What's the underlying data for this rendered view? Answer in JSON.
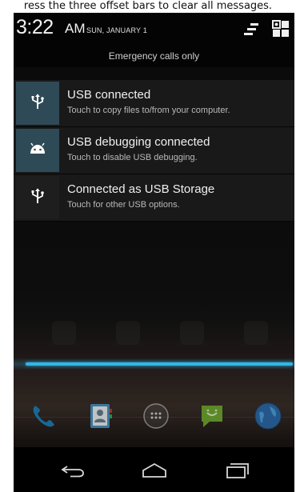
{
  "instruction": "ress the three offset bars to clear all messages.",
  "status": {
    "time": "3:22",
    "ampm": "AM",
    "date": "SUN, JANUARY 1",
    "clear_icon": "clear-all-icon",
    "settings_icon": "quick-settings-icon"
  },
  "emergency": "Emergency calls only",
  "notifications": [
    {
      "title": "USB connected",
      "text": "Touch to copy files to/from your computer.",
      "icon": "usb-icon",
      "icon_bg": "#2e4a56"
    },
    {
      "title": "USB debugging connected",
      "text": "Touch to disable USB debugging.",
      "icon": "android-bug-icon",
      "icon_bg": "#2e4a56"
    },
    {
      "title": "Connected as USB Storage",
      "text": "Touch for other USB options.",
      "icon": "usb-icon",
      "icon_bg": "#1e1e1e"
    }
  ],
  "dock": {
    "items": [
      "phone-icon",
      "contacts-icon",
      "app-drawer-icon",
      "messaging-icon",
      "browser-icon"
    ]
  },
  "navbar": {
    "items": [
      "back-icon",
      "home-icon",
      "recents-icon"
    ]
  },
  "colors": {
    "accent": "#33b5e5",
    "notification_bg": "#1a1a1a",
    "icon_blue_bg": "#2e4a56"
  }
}
